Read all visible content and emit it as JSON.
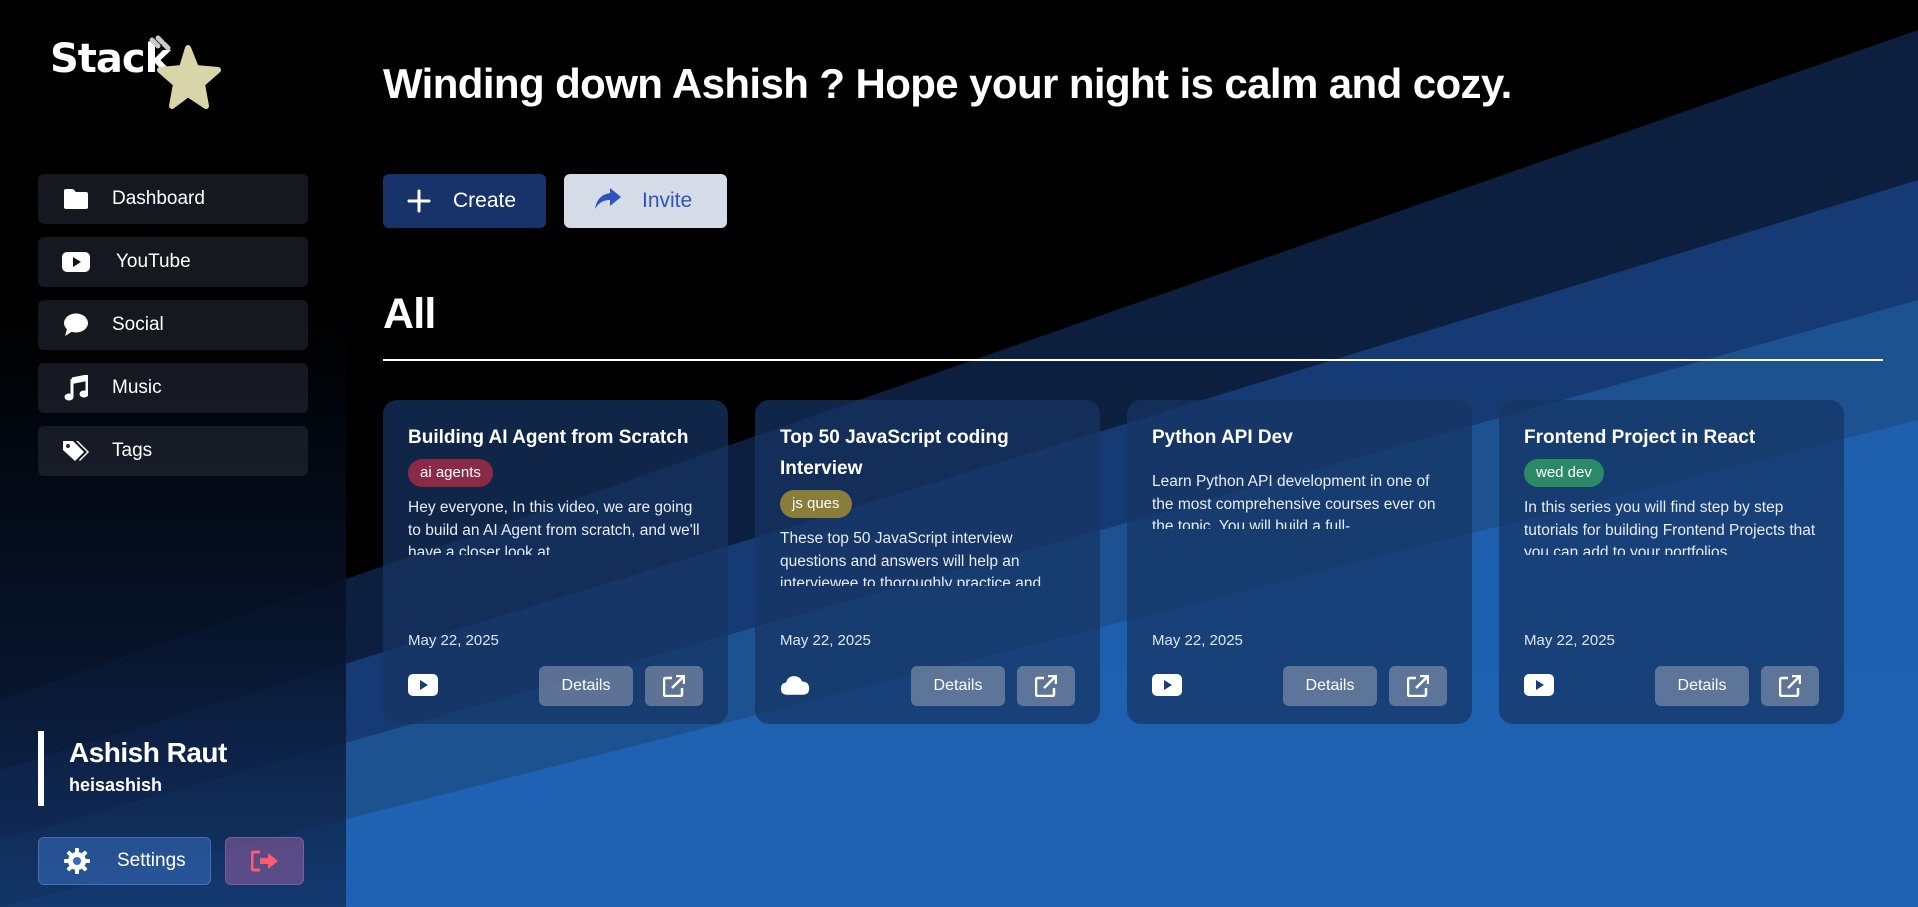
{
  "app": {
    "logo_text": "Stack"
  },
  "sidebar": {
    "items": [
      {
        "label": "Dashboard",
        "icon": "folder-icon"
      },
      {
        "label": "YouTube",
        "icon": "youtube-icon"
      },
      {
        "label": "Social",
        "icon": "chat-bubble-icon"
      },
      {
        "label": "Music",
        "icon": "music-note-icon"
      },
      {
        "label": "Tags",
        "icon": "tags-icon"
      }
    ],
    "user": {
      "name": "Ashish Raut",
      "handle": "heisashish"
    },
    "settings_label": "Settings",
    "logout_icon": "logout-icon"
  },
  "header": {
    "greeting": "Winding down Ashish ? Hope your night is calm and cozy.",
    "create_label": "Create",
    "invite_label": "Invite"
  },
  "section": {
    "title": "All"
  },
  "cards": [
    {
      "title": "Building AI Agent from Scratch",
      "tag": "ai agents",
      "tag_color": "#8a2a45",
      "description": "Hey everyone, In this video, we are going to build an AI Agent from scratch, and we'll have a closer look at",
      "date": "May 22, 2025",
      "source_icon": "youtube-icon",
      "details_label": "Details"
    },
    {
      "title": "Top 50 JavaScript coding Interview",
      "tag": "js ques",
      "tag_color": "#8a7d3a",
      "description": "These top 50 JavaScript interview questions and answers will help an interviewee to thoroughly practice and",
      "date": "May 22, 2025",
      "source_icon": "cloud-icon",
      "details_label": "Details"
    },
    {
      "title": "Python API Dev",
      "tag": "",
      "tag_color": "",
      "description": "Learn Python API development in one of the most comprehensive courses ever on the topic. You will build a full-",
      "date": "May 22, 2025",
      "source_icon": "youtube-icon",
      "details_label": "Details"
    },
    {
      "title": "Frontend Project in React",
      "tag": "wed dev",
      "tag_color": "#2a8a66",
      "description": "In this series you will find step by step tutorials for building Frontend Projects that you can add to your portfolios.",
      "date": "May 22, 2025",
      "source_icon": "youtube-icon",
      "details_label": "Details"
    }
  ],
  "colors": {
    "create_bg": "#17336a",
    "invite_bg": "#d6dbe8",
    "invite_text": "#2f55b8",
    "accent_blue": "#1f5fb0"
  }
}
